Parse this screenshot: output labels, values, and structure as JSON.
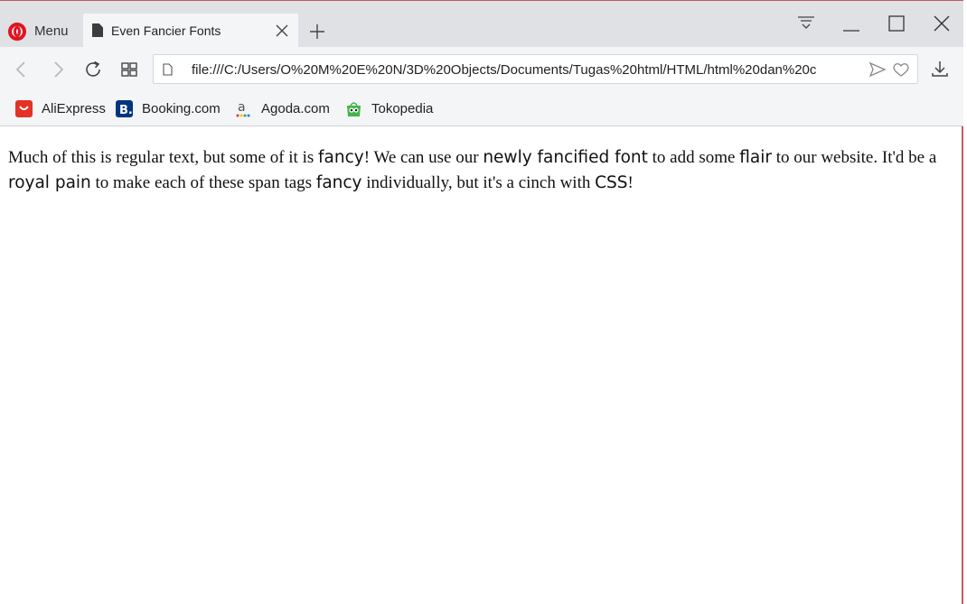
{
  "browser": {
    "menu_label": "Menu",
    "tab_title": "Even Fancier Fonts",
    "url": "file:///C:/Users/O%20M%20E%20N/3D%20Objects/Documents/Tugas%20html/HTML/html%20dan%20c",
    "accent_color": "#e0141e"
  },
  "bookmarks": [
    {
      "label": "AliExpress",
      "icon": "aliexpress-icon",
      "color": "#e43225"
    },
    {
      "label": "Booking.com",
      "icon": "booking-icon",
      "color": "#003580"
    },
    {
      "label": "Agoda.com",
      "icon": "agoda-icon",
      "color": "#555555"
    },
    {
      "label": "Tokopedia",
      "icon": "tokopedia-icon",
      "color": "#42b549"
    }
  ],
  "content": {
    "t1": "Much of this is regular text, but some of it is ",
    "f1": "fancy",
    "t2": "! We can use our ",
    "f2": "newly fancified font",
    "t3": " to add some ",
    "f3": "flair",
    "t4": " to our website. It'd be a ",
    "f4": "royal pain",
    "t5": " to make each of these span tags ",
    "f5": "fancy",
    "t6": " individually, but it's a cinch with ",
    "f6": "CSS",
    "t7": "!"
  }
}
